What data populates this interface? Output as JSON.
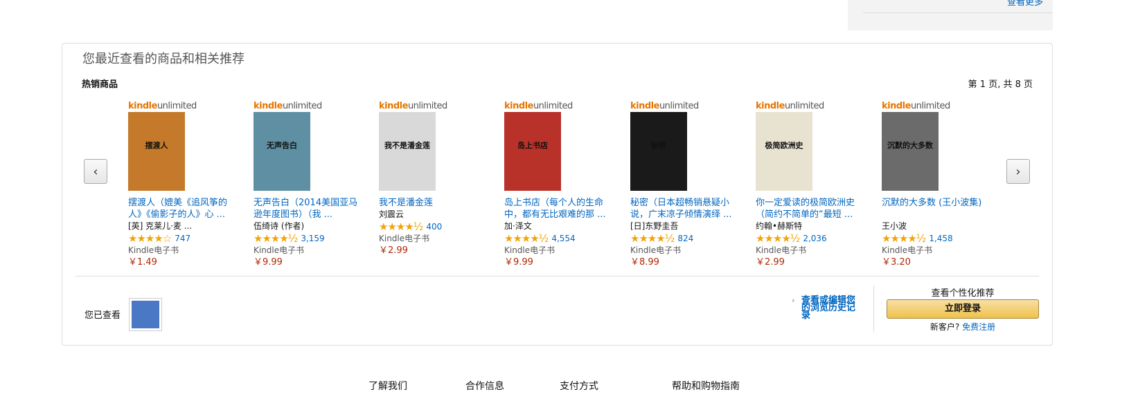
{
  "top": {
    "more_link": "查看更多"
  },
  "panel": {
    "title": "您最近查看的商品和相关推荐",
    "section_label": "热销商品",
    "page_count": "第 1 页, 共 8 页",
    "prev": "‹",
    "next": "›"
  },
  "badge": {
    "part1": "kindle",
    "part2": "unlimited"
  },
  "items": [
    {
      "cover_text": "摆渡人",
      "cover_color": "#c47a2a",
      "title": "摆渡人（媲美《追风筝的人》《偷影子的人》心 ...",
      "author": "[英] 克莱儿·麦 ...",
      "stars": "★★★★☆",
      "rating": 4,
      "count": "747",
      "format": "Kindle电子书",
      "price": "￥1.49"
    },
    {
      "cover_text": "无声告白",
      "cover_color": "#5e8fa3",
      "title": "无声告白（2014美国亚马逊年度图书）（我 ...",
      "author": "伍绮诗 (作者)",
      "stars": "★★★★½",
      "rating": 4.5,
      "count": "3,159",
      "format": "Kindle电子书",
      "price": "￥9.99"
    },
    {
      "cover_text": "我不是潘金莲",
      "cover_color": "#d9d9d9",
      "title": "我不是潘金莲",
      "author": "刘震云",
      "stars": "★★★★½",
      "rating": 4.5,
      "count": "400",
      "format": "Kindle电子书",
      "price": "￥2.99"
    },
    {
      "cover_text": "岛上书店",
      "cover_color": "#b8322a",
      "title": "岛上书店（每个人的生命中，都有无比艰难的那 ...",
      "author": "加·泽文",
      "stars": "★★★★½",
      "rating": 4.5,
      "count": "4,554",
      "format": "Kindle电子书",
      "price": "￥9.99"
    },
    {
      "cover_text": "秘密",
      "cover_color": "#1a1a1a",
      "title": "秘密（日本超畅销悬疑小说，广末凉子倾情演绎 ...",
      "author": "[日]东野圭吾",
      "stars": "★★★★½",
      "rating": 4.5,
      "count": "824",
      "format": "Kindle电子书",
      "price": "￥8.99"
    },
    {
      "cover_text": "极简欧洲史",
      "cover_color": "#e8e2d0",
      "title": "你一定爱读的极简欧洲史（简约不简单的“最短 ...",
      "author": "约翰•赫斯特",
      "stars": "★★★★½",
      "rating": 4.5,
      "count": "2,036",
      "format": "Kindle电子书",
      "price": "￥2.99"
    },
    {
      "cover_text": "沉默的大多数",
      "cover_color": "#6b6b6b",
      "title": "沉默的大多数 (王小波集)",
      "author": "王小波",
      "stars": "★★★★½",
      "rating": 4.5,
      "count": "1,458",
      "format": "Kindle电子书",
      "price": "￥3.20"
    }
  ],
  "viewed": {
    "label": "您已查看"
  },
  "history": {
    "link": "查看或编辑您的浏览历史记录"
  },
  "personal": {
    "title": "查看个性化推荐",
    "login": "立即登录",
    "new_customer": "新客户?",
    "register": "免费注册"
  },
  "footer": [
    "了解我们",
    "合作信息",
    "支付方式",
    "帮助和购物指南"
  ]
}
